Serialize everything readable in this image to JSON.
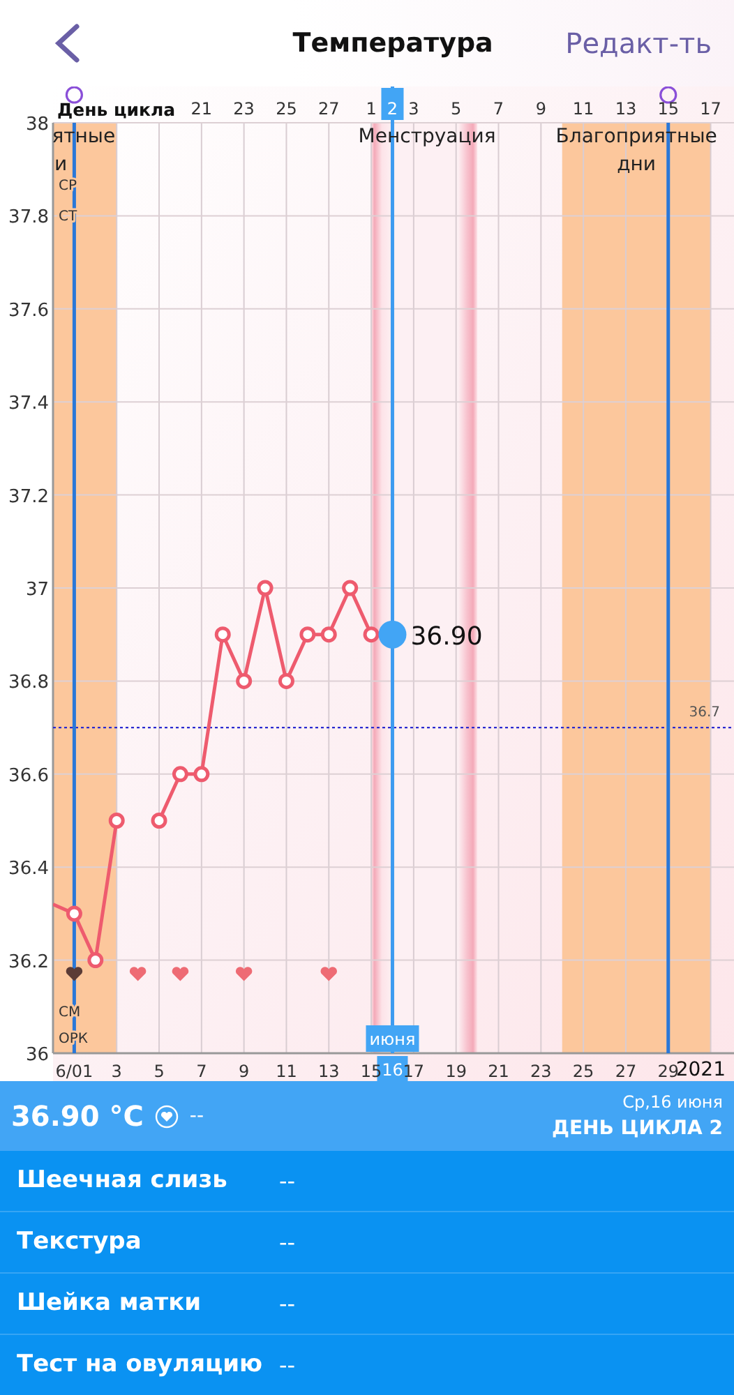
{
  "header": {
    "title": "Температура",
    "action": "Редакт-ть"
  },
  "chart": {
    "cycle_axis": {
      "title": "День цикла",
      "ticks": [
        {
          "label": "21",
          "selected": false
        },
        {
          "label": "23",
          "selected": false
        },
        {
          "label": "25",
          "selected": false
        },
        {
          "label": "27",
          "selected": false
        },
        {
          "label": "1",
          "selected": false
        },
        {
          "label": "2",
          "selected": true
        },
        {
          "label": "3",
          "selected": false
        },
        {
          "label": "5",
          "selected": false
        },
        {
          "label": "7",
          "selected": false
        },
        {
          "label": "9",
          "selected": false
        },
        {
          "label": "11",
          "selected": false
        },
        {
          "label": "13",
          "selected": false
        },
        {
          "label": "15",
          "selected": false
        },
        {
          "label": "17",
          "selected": false
        }
      ]
    },
    "bands": [
      {
        "kind": "fertile",
        "label": [
          "ятные",
          "и"
        ]
      },
      {
        "kind": "menstruation",
        "label": [
          "Менструация"
        ]
      },
      {
        "kind": "fertile",
        "label": [
          "Благоприятные",
          "дни"
        ]
      }
    ],
    "vertical_lines": [
      {
        "kind": "ovulation"
      },
      {
        "kind": "ovulation"
      },
      {
        "kind": "selected"
      }
    ],
    "notes_top": [
      "СР",
      "СТ"
    ],
    "notes_bottom": [
      "СМ",
      "ОРК"
    ],
    "hearts": [
      {
        "color": "#5b3b36"
      },
      {
        "color": "#ee6b74"
      },
      {
        "color": "#ee6b74"
      },
      {
        "color": "#ee6b74"
      },
      {
        "color": "#ee6b74"
      }
    ],
    "selected": {
      "value_label": "36.90",
      "month": "июня",
      "day": "16"
    },
    "year": "2021",
    "start_date": "6/01",
    "chart_data": {
      "type": "line",
      "xlim": [
        0,
        32.1
      ],
      "ylim": [
        36,
        38
      ],
      "grid": true,
      "x": [
        0,
        1,
        2,
        3,
        4,
        5,
        6,
        7,
        8,
        9,
        10,
        11,
        12,
        13,
        14,
        15,
        16
      ],
      "series": [
        {
          "color": "#ee5b6e",
          "marker": "o",
          "values": [
            36.32,
            36.3,
            36.2,
            36.5,
            null,
            36.5,
            36.6,
            36.6,
            36.9,
            36.8,
            37.0,
            36.8,
            36.9,
            36.9,
            37.0,
            36.9,
            36.9
          ]
        }
      ],
      "yticks": [
        {
          "value": 36,
          "label": "36"
        },
        {
          "value": 36.2,
          "label": "36.2"
        },
        {
          "value": 36.4,
          "label": "36.4"
        },
        {
          "value": 36.6,
          "label": "36.6"
        },
        {
          "value": 36.8,
          "label": "36.8"
        },
        {
          "value": 37,
          "label": "37"
        },
        {
          "value": 37.2,
          "label": "37.2"
        },
        {
          "value": 37.4,
          "label": "37.4"
        },
        {
          "value": 37.6,
          "label": "37.6"
        },
        {
          "value": 37.8,
          "label": "37.8"
        },
        {
          "value": 38,
          "label": "38"
        }
      ],
      "xticks": [
        {
          "value": 3,
          "label": "3"
        },
        {
          "value": 5,
          "label": "5"
        },
        {
          "value": 7,
          "label": "7"
        },
        {
          "value": 9,
          "label": "9"
        },
        {
          "value": 11,
          "label": "11"
        },
        {
          "value": 13,
          "label": "13"
        },
        {
          "value": 15,
          "label": "15"
        },
        {
          "value": 17,
          "label": "17"
        },
        {
          "value": 19,
          "label": "19"
        },
        {
          "value": 21,
          "label": "21"
        },
        {
          "value": 23,
          "label": "23"
        },
        {
          "value": 25,
          "label": "25"
        },
        {
          "value": 27,
          "label": "27"
        },
        {
          "value": 29,
          "label": "29"
        }
      ],
      "bands": [
        {
          "axis": "x",
          "from": 0,
          "to": 3
        },
        {
          "axis": "x",
          "from": 15,
          "to": 20
        },
        {
          "axis": "x",
          "from": 24,
          "to": 31
        }
      ],
      "ref_lines": [
        {
          "axis": "y",
          "value": 36.7,
          "label": "36.7"
        },
        {
          "axis": "x",
          "value": 1
        },
        {
          "axis": "x",
          "value": 29
        },
        {
          "axis": "x",
          "value": 16
        }
      ]
    }
  },
  "summary": {
    "temperature": "36.90 °C",
    "sex": "--",
    "date": "Ср,16 июня",
    "cycle_day": "ДЕНЬ ЦИКЛА 2"
  },
  "rows": [
    {
      "label": "Шеечная слизь",
      "value": "--"
    },
    {
      "label": "Текстура",
      "value": "--"
    },
    {
      "label": "Шейка матки",
      "value": "--"
    },
    {
      "label": "Тест на овуляцию",
      "value": "--"
    }
  ]
}
